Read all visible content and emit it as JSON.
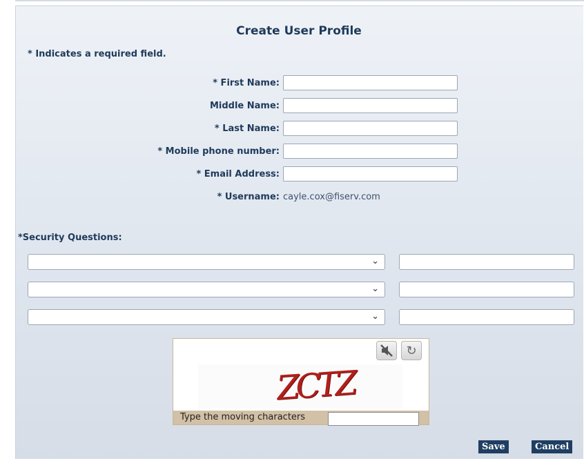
{
  "form": {
    "title": "Create User Profile",
    "required_note": "* Indicates a required field.",
    "fields": {
      "first_name": "* First Name:",
      "middle_name": "Middle Name:",
      "last_name": "* Last Name:",
      "mobile_phone": "* Mobile phone number:",
      "email": "* Email Address:",
      "username_label": "* Username:",
      "username_value": "cayle.cox@fiserv.com"
    },
    "security": {
      "label": "*Security Questions:"
    }
  },
  "captcha": {
    "characters": "ZCTZ",
    "prompt": "Type the moving characters",
    "icons": [
      "mute-audio-icon",
      "refresh-icon"
    ]
  },
  "actions": {
    "save": "Save",
    "cancel": "Cancel"
  },
  "colors": {
    "label_text": "#1f3a5a",
    "button_bg": "#1f3f62",
    "captcha_text": "#b0201c",
    "captcha_bar": "#d2c1a6"
  }
}
